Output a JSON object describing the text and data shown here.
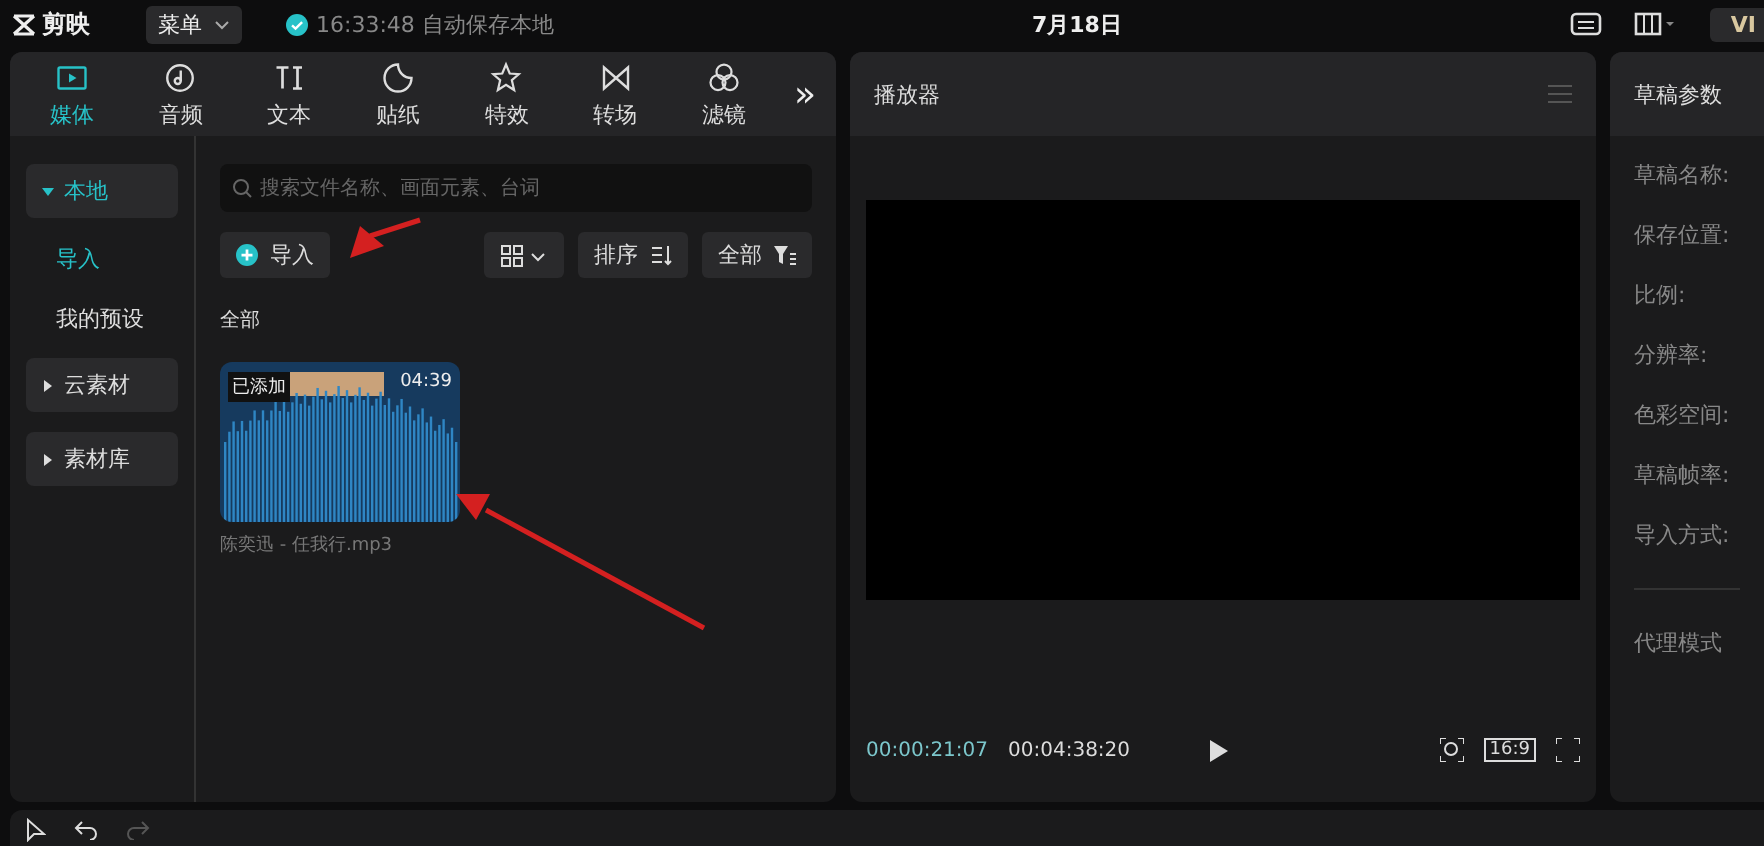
{
  "title_bar": {
    "app_name": "剪映",
    "menu_button": "菜单",
    "save_status": "16:33:48 自动保存本地",
    "project_title": "7月18日",
    "vip_badge": "VI"
  },
  "media_panel": {
    "tabs": [
      {
        "label": "媒体",
        "selected": true
      },
      {
        "label": "音频",
        "selected": false
      },
      {
        "label": "文本",
        "selected": false
      },
      {
        "label": "贴纸",
        "selected": false
      },
      {
        "label": "特效",
        "selected": false
      },
      {
        "label": "转场",
        "selected": false
      },
      {
        "label": "滤镜",
        "selected": false
      }
    ],
    "more_tabs": "»",
    "sidebar": [
      {
        "label": "本地",
        "kind": "group",
        "expanded": true,
        "selected": true
      },
      {
        "label": "导入",
        "kind": "sub",
        "selected": true
      },
      {
        "label": "我的预设",
        "kind": "sub",
        "selected": false
      },
      {
        "label": "云素材",
        "kind": "group",
        "expanded": false,
        "selected": false
      },
      {
        "label": "素材库",
        "kind": "group",
        "expanded": false,
        "selected": false
      }
    ],
    "search": {
      "placeholder": "搜索文件名称、画面元素、台词"
    },
    "import_button": "导入",
    "sort_button": "排序",
    "filter_button": "全部",
    "section_label": "全部",
    "items": [
      {
        "badge": "已添加",
        "duration": "04:39",
        "filename": "陈奕迅 - 任我行.mp3"
      }
    ]
  },
  "player": {
    "title": "播放器",
    "current_time": "00:00:21:07",
    "total_time": "00:04:38:20",
    "ratio": "16:9"
  },
  "draft_panel": {
    "title": "草稿参数",
    "fields": [
      "草稿名称:",
      "保存位置:",
      "比例:",
      "分辨率:",
      "色彩空间:",
      "草稿帧率:",
      "导入方式:"
    ],
    "proxy_label": "代理模式"
  }
}
